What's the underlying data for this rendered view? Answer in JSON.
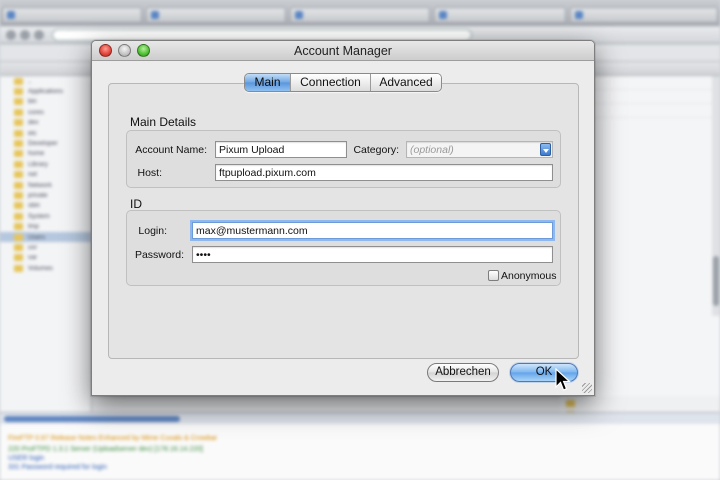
{
  "background": {
    "log": {
      "line1": "FireFTP 0.97 Release Notes",
      "line1_extra": "Enhanced by Mime Cuvalo & Crowbar",
      "line2": "220 ProFTPD 1.3.1 Server (Uploadserver dev) [178.16.14.220]",
      "line3": "USER login",
      "line4": "331 Password required for login"
    },
    "sidebar_items": [
      "..",
      "Applications",
      "bin",
      "cores",
      "dev",
      "etc",
      "Developer",
      "home",
      "Library",
      "net",
      "Network",
      "private",
      "sbin",
      "System",
      "tmp",
      "Users",
      "usr",
      "var",
      "Volumes"
    ]
  },
  "dialog": {
    "title": "Account Manager",
    "tabs": [
      {
        "label": "Main"
      },
      {
        "label": "Connection"
      },
      {
        "label": "Advanced"
      }
    ],
    "main_details": {
      "heading": "Main Details",
      "account_name_label": "Account Name:",
      "account_name_value": "Pixum Upload",
      "category_label": "Category:",
      "category_placeholder": "(optional)",
      "host_label": "Host:",
      "host_value": "ftpupload.pixum.com"
    },
    "id_section": {
      "heading": "ID",
      "login_label": "Login:",
      "login_value": "max@mustermann.com",
      "password_label": "Password:",
      "password_value": "••••",
      "anonymous_label": "Anonymous",
      "anonymous_checked": false
    },
    "buttons": {
      "cancel": "Abbrechen",
      "ok": "OK"
    }
  },
  "colors": {
    "accent": "#6ea6e4",
    "close": "#e0443a",
    "zoom": "#4fbf34"
  }
}
